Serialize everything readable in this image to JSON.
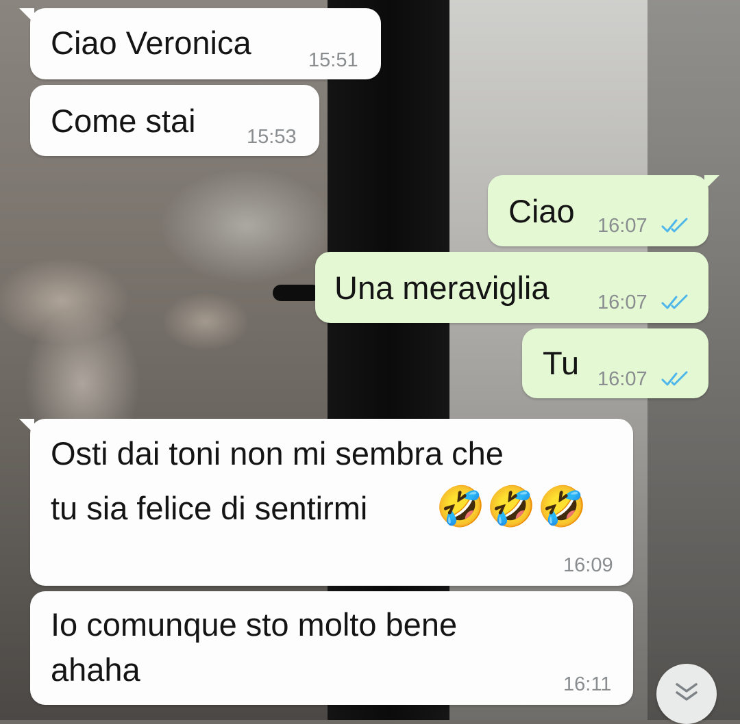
{
  "messages": [
    {
      "dir": "in",
      "text": "Ciao Veronica",
      "time": "15:51"
    },
    {
      "dir": "in",
      "text": "Come stai",
      "time": "15:53"
    },
    {
      "dir": "out",
      "text": "Ciao",
      "time": "16:07",
      "status": "read-double-check-icon"
    },
    {
      "dir": "out",
      "text": "Una meraviglia",
      "time": "16:07",
      "status": "read-double-check-icon"
    },
    {
      "dir": "out",
      "text": "Tu",
      "time": "16:07",
      "status": "read-double-check-icon"
    },
    {
      "dir": "in",
      "text_line1": "Osti dai toni non mi sembra che",
      "text_line2": "tu sia felice di sentirmi",
      "emoji": "🤣🤣🤣",
      "time": "16:09"
    },
    {
      "dir": "in",
      "text_line1": "Io comunque sto molto bene",
      "text_line2": "ahaha",
      "time": "16:11"
    }
  ],
  "colors": {
    "incoming_bubble": "#fdfdfd",
    "outgoing_bubble": "#e4f8d4",
    "read_ticks": "#4fb6ec",
    "timestamp": "#8a8d8f"
  },
  "scroll_button": {
    "icon": "double-chevron-down-icon"
  }
}
